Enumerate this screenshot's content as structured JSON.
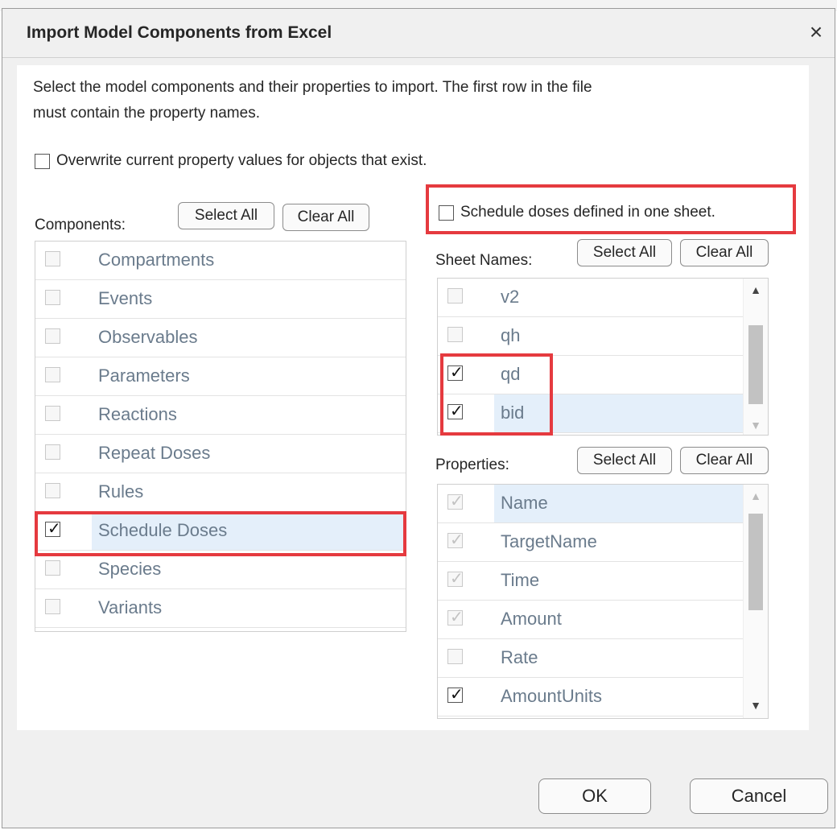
{
  "dialog": {
    "title": "Import Model Components from Excel",
    "close_symbol": "×",
    "intro_line1": "Select the model components and their properties to import. The first row in the file",
    "intro_line2": "must contain the property names.",
    "overwrite_label": "Overwrite current property values for objects that exist.",
    "schedule_label": "Schedule doses defined in one sheet."
  },
  "components": {
    "label": "Components:",
    "select_all": "Select All",
    "clear_all": "Clear All",
    "items": [
      {
        "label": "Compartments",
        "checked": false
      },
      {
        "label": "Events",
        "checked": false
      },
      {
        "label": "Observables",
        "checked": false
      },
      {
        "label": "Parameters",
        "checked": false
      },
      {
        "label": "Reactions",
        "checked": false
      },
      {
        "label": "Repeat Doses",
        "checked": false
      },
      {
        "label": "Rules",
        "checked": false
      },
      {
        "label": "Schedule Doses",
        "checked": true
      },
      {
        "label": "Species",
        "checked": false
      },
      {
        "label": "Variants",
        "checked": false
      }
    ]
  },
  "sheets": {
    "label": "Sheet Names:",
    "select_all": "Select All",
    "clear_all": "Clear All",
    "items": [
      {
        "label": "v2",
        "checked": false
      },
      {
        "label": "qh",
        "checked": false
      },
      {
        "label": "qd",
        "checked": true
      },
      {
        "label": "bid",
        "checked": true
      }
    ]
  },
  "properties": {
    "label": "Properties:",
    "select_all": "Select All",
    "clear_all": "Clear All",
    "items": [
      {
        "label": "Name",
        "checked": true,
        "disabled": true
      },
      {
        "label": "TargetName",
        "checked": true,
        "disabled": true
      },
      {
        "label": "Time",
        "checked": true,
        "disabled": true
      },
      {
        "label": "Amount",
        "checked": true,
        "disabled": true
      },
      {
        "label": "Rate",
        "checked": false,
        "disabled": false
      },
      {
        "label": "AmountUnits",
        "checked": true,
        "disabled": false
      }
    ]
  },
  "footer": {
    "ok": "OK",
    "cancel": "Cancel"
  },
  "colors": {
    "highlight": "#e53a3f",
    "selection": "#e4effa"
  },
  "icons": {
    "check": "✓",
    "scroll_up": "▲",
    "scroll_down": "▼"
  }
}
